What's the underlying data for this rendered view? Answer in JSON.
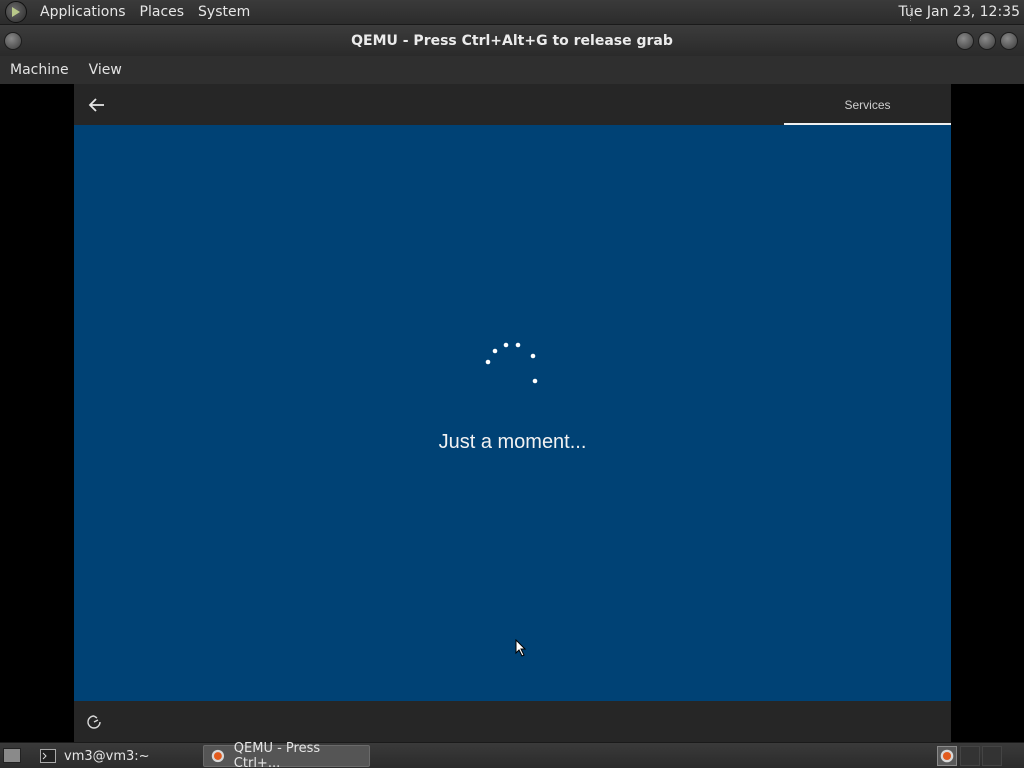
{
  "top_panel": {
    "menus": [
      "Applications",
      "Places",
      "System"
    ],
    "clock": "Tue Jan 23, 12:35"
  },
  "window": {
    "title": "QEMU - Press Ctrl+Alt+G to release grab",
    "menu": [
      "Machine",
      "View"
    ]
  },
  "oobe": {
    "tab_label": "Services",
    "status_text": "Just a moment...",
    "colors": {
      "background": "#004275",
      "header": "#262626"
    }
  },
  "taskbar": {
    "tasks": [
      {
        "label": "vm3@vm3:~",
        "icon": "terminal-icon"
      },
      {
        "label": "QEMU - Press Ctrl+...",
        "icon": "qemu-icon"
      }
    ]
  }
}
